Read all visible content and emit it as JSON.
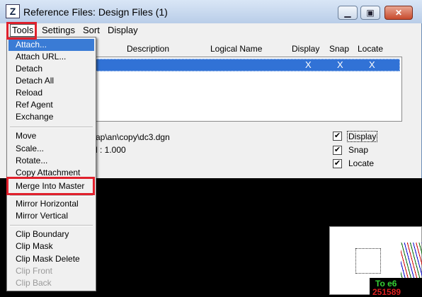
{
  "window": {
    "title": "Reference Files: Design Files (1)",
    "minimize_glyph": "▁",
    "maximize_glyph": "▣",
    "close_glyph": "✕"
  },
  "menubar": {
    "tools": "Tools",
    "settings": "Settings",
    "sort": "Sort",
    "display": "Display"
  },
  "columns": {
    "description": "Description",
    "logical_name": "Logical Name",
    "display": "Display",
    "snap": "Snap",
    "locate": "Locate"
  },
  "selected_row": {
    "display_mark": "X",
    "snap_mark": "X",
    "locate_mark": "X"
  },
  "details": {
    "path": "ap\\an\\copy\\dc3.dgn",
    "scale": "l : 1.000"
  },
  "checkboxes": [
    {
      "label": "Display",
      "checked": true
    },
    {
      "label": "Snap",
      "checked": true
    },
    {
      "label": "Locate",
      "checked": true
    }
  ],
  "tools_menu": {
    "groups": [
      [
        "Attach...",
        "Attach URL...",
        "Detach",
        "Detach All",
        "Reload",
        "Ref Agent",
        "Exchange"
      ],
      [
        "Move",
        "Scale...",
        "Rotate...",
        "Copy Attachment",
        "Merge Into Master"
      ],
      [
        "Mirror Horizontal",
        "Mirror Vertical"
      ],
      [
        "Clip Boundary",
        "Clip Mask",
        "Clip Mask Delete",
        "Clip Front",
        "Clip Back"
      ]
    ],
    "selected": "Attach...",
    "disabled": [
      "Clip Front",
      "Clip Back"
    ],
    "highlighted": "Merge Into Master"
  },
  "cad_view": {
    "label_top": "To e6",
    "label_bottom": "251589"
  },
  "colors": {
    "selection": "#3a7bd5",
    "highlight_box": "#e0202c",
    "cad_background": "#000000"
  }
}
